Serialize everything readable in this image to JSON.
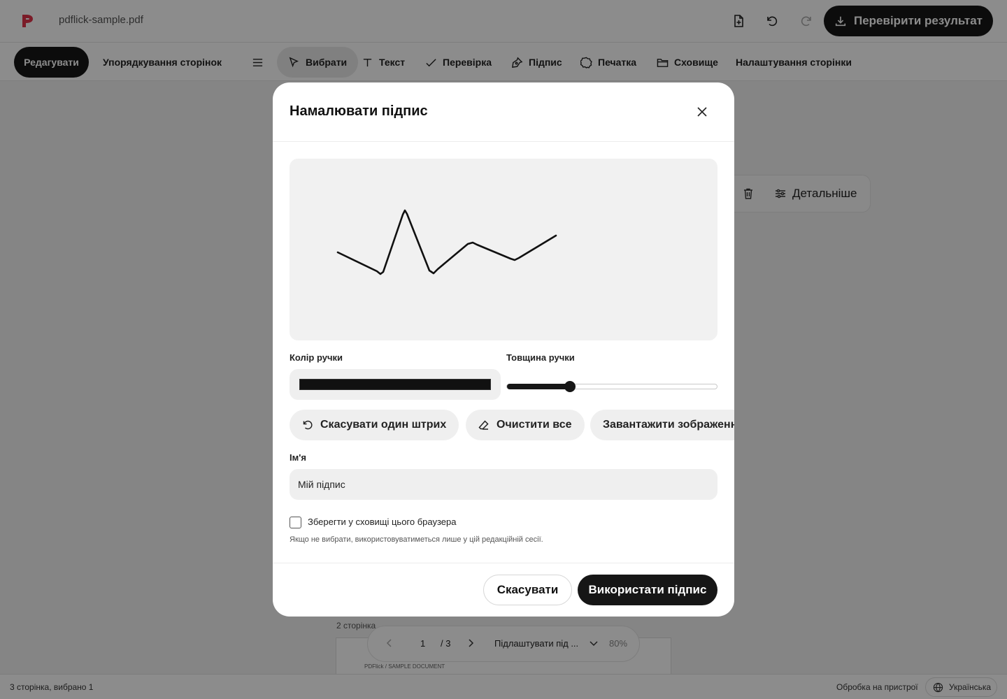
{
  "app": {
    "filename": "pdflick-sample.pdf",
    "export_label": "Перевірити результат",
    "brand_color": "#e0334a"
  },
  "toolbar": {
    "edit": "Редагувати",
    "arrange": "Упорядкування сторінок",
    "select": "Вибрати",
    "text": "Текст",
    "check": "Перевірка",
    "signature": "Підпис",
    "stamp": "Печатка",
    "storage": "Сховище",
    "page_settings": "Налаштування сторінки"
  },
  "float_bar": {
    "more_label": "Детальніше"
  },
  "document": {
    "page2_label": "2 сторінка",
    "page2_header": "PDFlick / SAMPLE DOCUMENT"
  },
  "pager": {
    "current": "1",
    "total": "/ 3",
    "fit_label": "Підлаштувати під ...",
    "zoom": "80%"
  },
  "status": {
    "left": "3 сторінка, вибрано 1",
    "processing": "Обробка на пристрої",
    "language": "Українська"
  },
  "modal": {
    "title": "Намалювати підпис",
    "pen_color_label": "Колір ручки",
    "pen_color": "#111111",
    "pen_width_label": "Товщина ручки",
    "pen_width_level": 0.3,
    "undo_stroke": "Скасувати один штрих",
    "clear_all": "Очистити все",
    "upload_image": "Завантажити зображення",
    "name_label": "Ім'я",
    "name_value": "Мій підпис",
    "save_label": "Зберегти у сховищі цього браузера",
    "save_checked": false,
    "hint": "Якщо не вибрати, використовуватиметься лише у цій редакційній сесії.",
    "cancel": "Скасувати",
    "use": "Використати підпис"
  }
}
